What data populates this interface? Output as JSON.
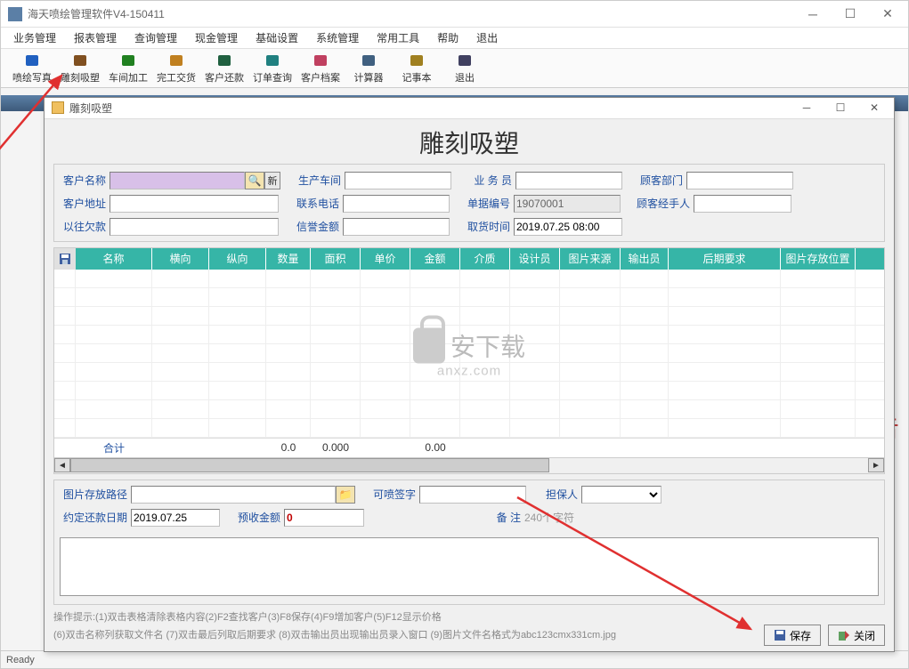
{
  "window": {
    "title": "海天喷绘管理软件V4-150411"
  },
  "menu": [
    "业务管理",
    "报表管理",
    "查询管理",
    "现金管理",
    "基础设置",
    "系统管理",
    "常用工具",
    "帮助",
    "退出"
  ],
  "toolbar": [
    {
      "label": "喷绘写真",
      "icon": "print-icon",
      "color": "#2060c0"
    },
    {
      "label": "雕刻吸塑",
      "icon": "barcode-icon",
      "color": "#805020"
    },
    {
      "label": "车间加工",
      "icon": "gear-icon",
      "color": "#208020"
    },
    {
      "label": "完工交货",
      "icon": "package-icon",
      "color": "#c08020"
    },
    {
      "label": "客户还款",
      "icon": "user-icon",
      "color": "#206040"
    },
    {
      "label": "订单查询",
      "icon": "calendar-icon",
      "color": "#208080"
    },
    {
      "label": "客户档案",
      "icon": "contacts-icon",
      "color": "#c04060"
    },
    {
      "label": "计算器",
      "icon": "calculator-icon",
      "color": "#406080"
    },
    {
      "label": "记事本",
      "icon": "notebook-icon",
      "color": "#a08020"
    },
    {
      "label": "退出",
      "icon": "exit-icon",
      "color": "#404060"
    }
  ],
  "side_text": "告",
  "dialog": {
    "title": "雕刻吸塑",
    "heading": "雕刻吸塑",
    "fields": {
      "customer_name_lbl": "客户名称",
      "customer_name": "",
      "new_btn": "新",
      "workshop_lbl": "生产车间",
      "workshop": "",
      "salesman_lbl": "业 务 员",
      "salesman": "",
      "dept_lbl": "顾客部门",
      "dept": "",
      "address_lbl": "客户地址",
      "address": "",
      "phone_lbl": "联系电话",
      "phone": "",
      "bill_no_lbl": "单据编号",
      "bill_no": "19070001",
      "handler_lbl": "顾客经手人",
      "handler": "",
      "debt_lbl": "以往欠款",
      "debt": "",
      "credit_lbl": "信誉金额",
      "credit": "",
      "pickup_lbl": "取货时间",
      "pickup": "2019.07.25 08:00"
    },
    "grid": {
      "headers": [
        "名称",
        "横向",
        "纵向",
        "数量",
        "面积",
        "单价",
        "金额",
        "介质",
        "设计员",
        "图片来源",
        "输出员",
        "后期要求",
        "图片存放位置"
      ],
      "sum_label": "合计",
      "sum_qty": "0.0",
      "sum_area": "0.000",
      "sum_amt": "0.00"
    },
    "bottom": {
      "img_path_lbl": "图片存放路径",
      "img_path": "",
      "signable_lbl": "可喷签字",
      "signable": "",
      "sponsor_lbl": "担保人",
      "sponsor": "",
      "repay_date_lbl": "约定还款日期",
      "repay_date": "2019.07.25",
      "prepay_lbl": "预收金额",
      "prepay": "0",
      "remark_lbl": "备  注",
      "remark_ph": "240个字符"
    },
    "hints": {
      "line1": "操作提示:(1)双击表格清除表格内容(2)F2查找客户(3)F8保存(4)F9增加客户(5)F12显示价格",
      "line2": "(6)双击名称列获取文件名   (7)双击最后列取后期要求   (8)双击输出员出现输出员录入窗口  (9)图片文件名格式为abc123cmx331cm.jpg"
    },
    "buttons": {
      "save": "保存",
      "close": "关闭"
    }
  },
  "watermark": {
    "text": "安下载",
    "url": "anxz.com"
  },
  "status": "Ready"
}
